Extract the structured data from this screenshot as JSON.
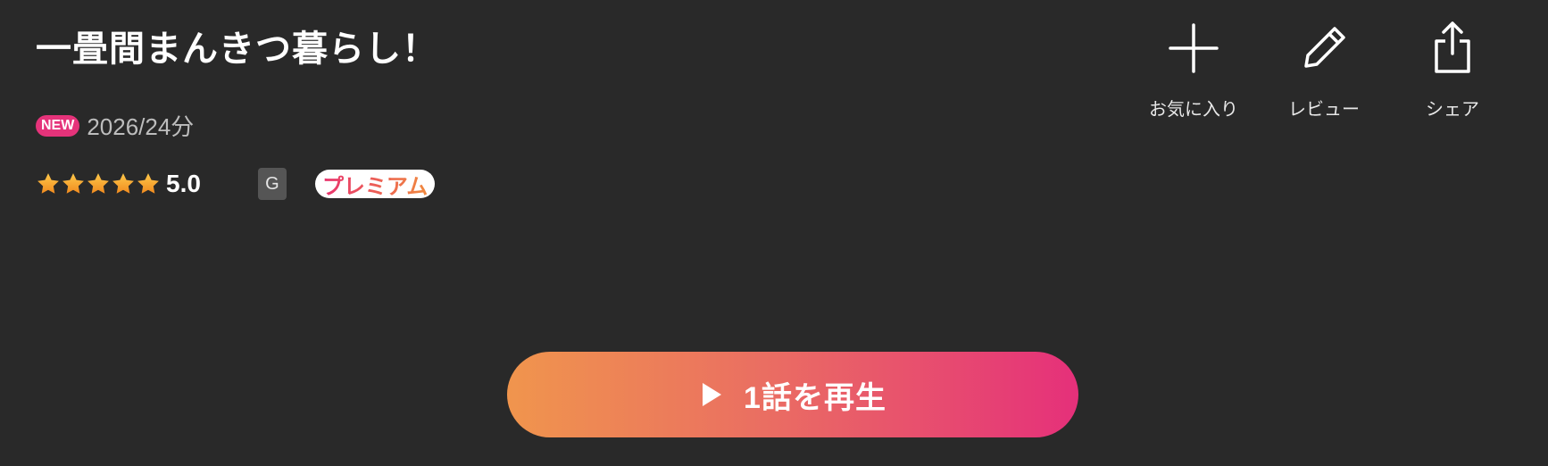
{
  "title": "一畳間まんきつ暮らし！",
  "meta": {
    "new_badge": "NEW",
    "year_length": "2026/24分"
  },
  "rating": {
    "stars": 5,
    "value": "5.0"
  },
  "age_rating": "G",
  "premium_badge": "プレミアム",
  "actions": {
    "favorite_label": "お気に入り",
    "review_label": "レビュー",
    "share_label": "シェア"
  },
  "play_button": {
    "label": "1話を再生"
  },
  "colors": {
    "background": "#292929",
    "new_badge": "#e5337a",
    "gradient_start": "#f0954d",
    "gradient_end": "#e5307a",
    "star": "#f6a623"
  }
}
